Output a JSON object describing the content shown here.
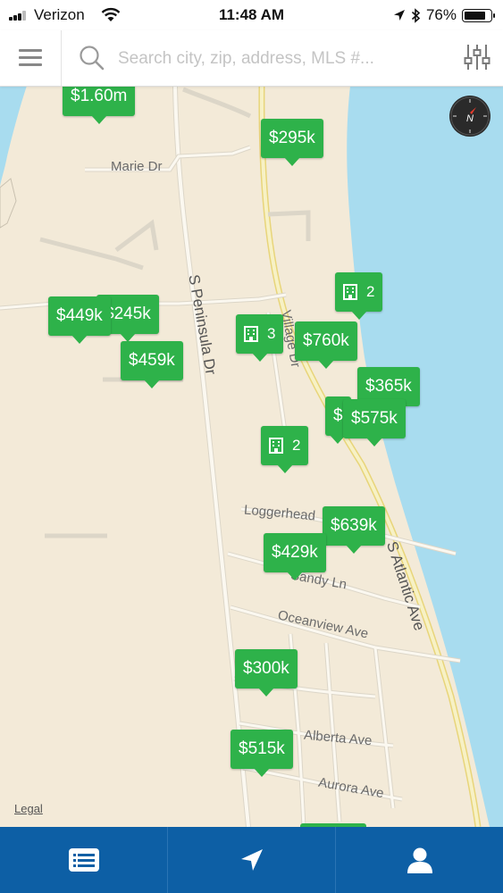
{
  "status_bar": {
    "carrier": "Verizon",
    "time": "11:48 AM",
    "battery": "76%"
  },
  "search": {
    "placeholder": "Search city, zip, address, MLS #..."
  },
  "map": {
    "roads": [
      "Marie Dr",
      "S Peninsula Dr",
      "Village Dr",
      "Loggerhead",
      "Sandy Ln",
      "S Atlantic Ave",
      "Oceanview Ave",
      "Alberta Ave",
      "Aurora Ave"
    ],
    "legal": "Legal",
    "listings": [
      {
        "label": "$1.60m"
      },
      {
        "label": "$295k"
      },
      {
        "label": "$449k"
      },
      {
        "label": "$245k"
      },
      {
        "label": "$459k"
      },
      {
        "label": "$760k"
      },
      {
        "label": "$365k"
      },
      {
        "label": "$575k"
      },
      {
        "label": "$639k"
      },
      {
        "label": "$429k"
      },
      {
        "label": "$300k"
      },
      {
        "label": "$515k"
      }
    ],
    "clusters": [
      {
        "count": "2"
      },
      {
        "count": "3"
      },
      {
        "count": "2"
      }
    ]
  },
  "bottom_nav": {
    "items": [
      "list-icon",
      "location-arrow-icon",
      "user-icon"
    ]
  },
  "colors": {
    "pin_green": "#2eb24a",
    "nav_blue": "#0d5fa5",
    "water": "#a8dcef",
    "land": "#f3ead8"
  }
}
